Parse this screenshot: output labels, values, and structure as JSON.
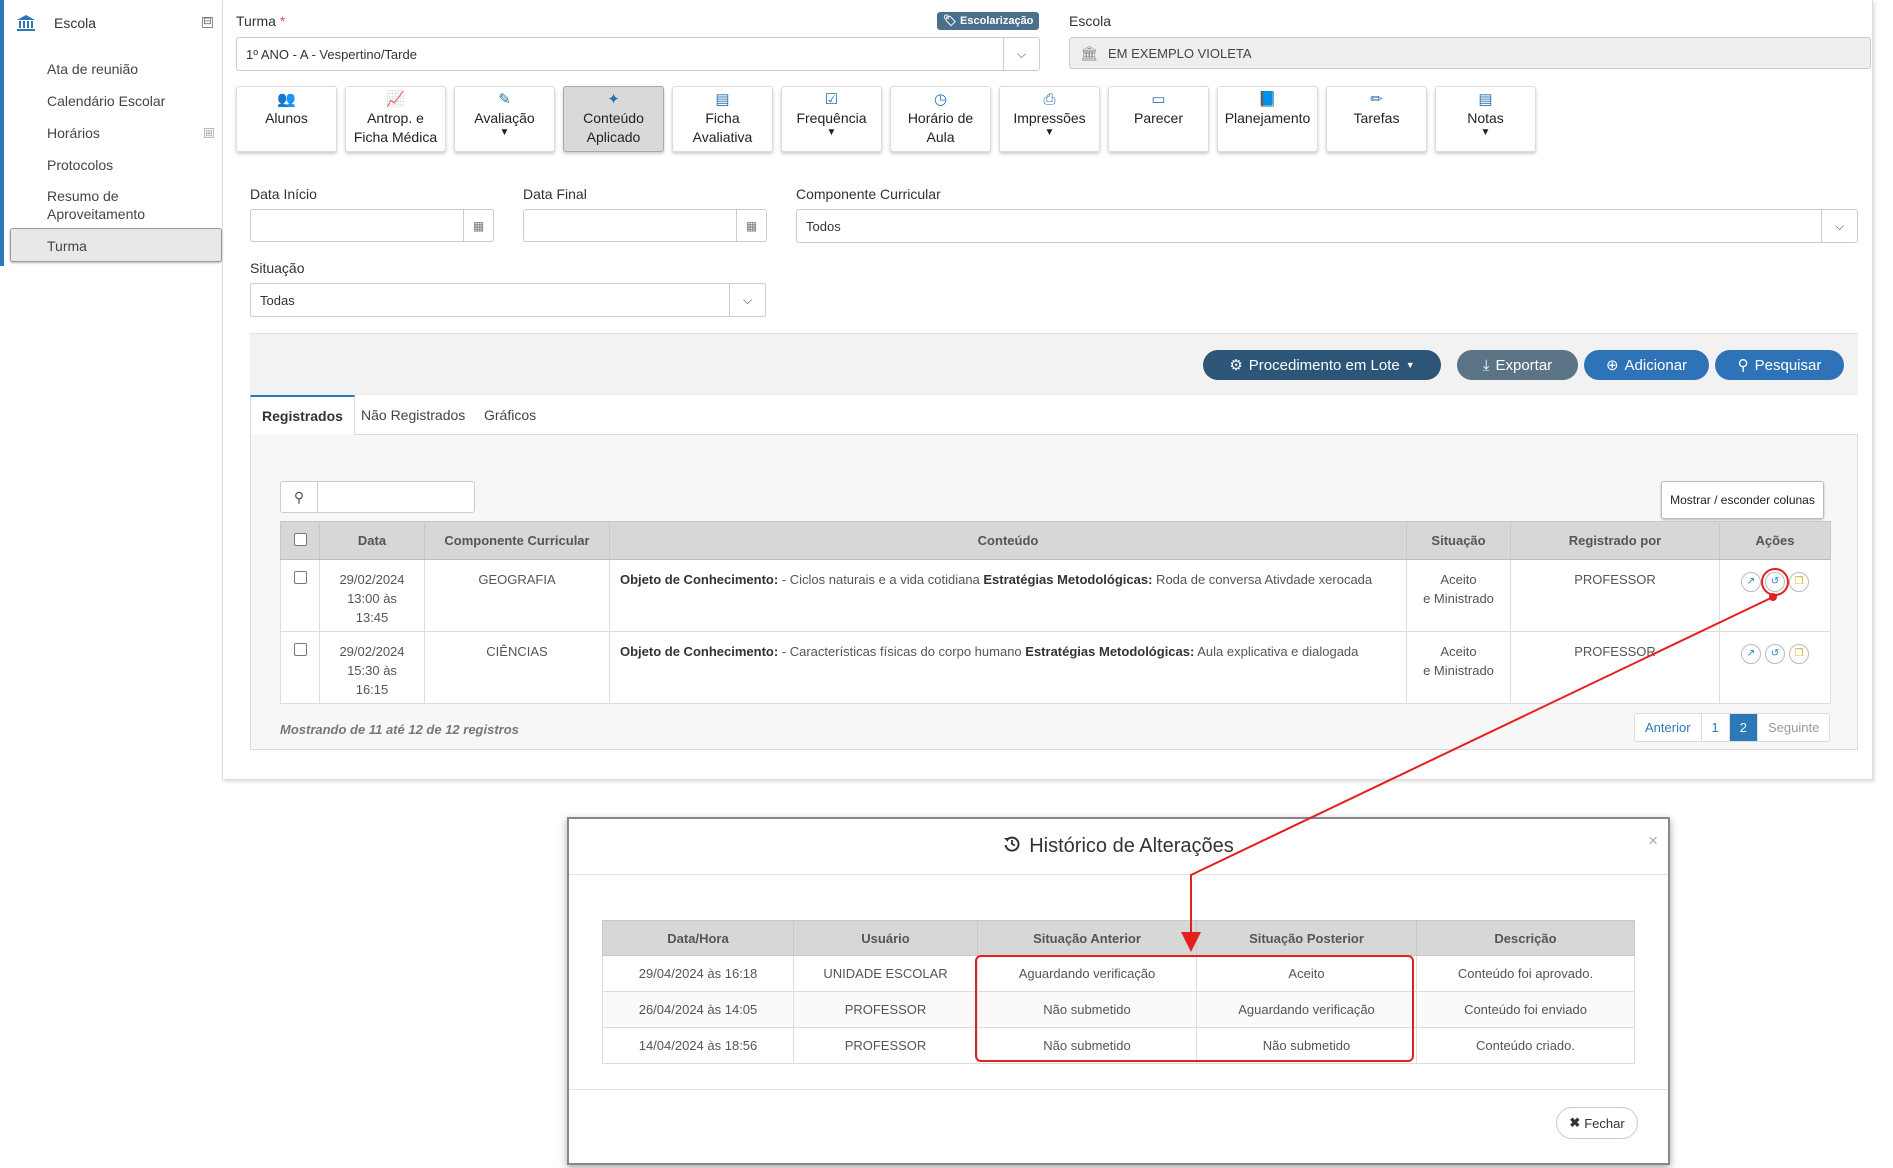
{
  "sidebar": {
    "header": "Escola",
    "header_toggle": "⊟",
    "items": [
      {
        "label": "Ata de reunião"
      },
      {
        "label": "Calendário Escolar"
      },
      {
        "label": "Horários",
        "toggle": "⊞"
      },
      {
        "label": "Protocolos"
      },
      {
        "label": "Resumo de Aproveitamento"
      },
      {
        "label": "Turma",
        "active": true
      }
    ]
  },
  "form": {
    "turma_label": "Turma",
    "turma_required": "*",
    "turma_value": "1º ANO - A - Vespertino/Tarde",
    "tag": "Escolarização",
    "escola_label": "Escola",
    "escola_value": "EM EXEMPLO VIOLETA"
  },
  "tiles": [
    {
      "icon": "users-icon",
      "glyph": "👥",
      "line1": "Alunos",
      "line2": ""
    },
    {
      "icon": "line-chart-icon",
      "glyph": "📈",
      "line1": "Antrop. e",
      "line2": "Ficha Médica"
    },
    {
      "icon": "edit-icon",
      "glyph": "✎",
      "line1": "Avaliação",
      "line2": "",
      "dropdown": true
    },
    {
      "icon": "magic-wand-icon",
      "glyph": "✦",
      "line1": "Conteúdo",
      "line2": "Aplicado",
      "active": true
    },
    {
      "icon": "table-icon",
      "glyph": "▤",
      "line1": "Ficha",
      "line2": "Avaliativa"
    },
    {
      "icon": "check-square-icon",
      "glyph": "☑",
      "line1": "Frequência",
      "line2": "",
      "dropdown": true
    },
    {
      "icon": "clock-icon",
      "glyph": "◷",
      "line1": "Horário de",
      "line2": "Aula"
    },
    {
      "icon": "print-icon",
      "glyph": "⎙",
      "line1": "Impressões",
      "line2": "",
      "dropdown": true
    },
    {
      "icon": "file-text-icon",
      "glyph": "▭",
      "line1": "Parecer",
      "line2": ""
    },
    {
      "icon": "book-icon",
      "glyph": "📘",
      "line1": "Planejamento",
      "line2": ""
    },
    {
      "icon": "pencil-icon",
      "glyph": "✏",
      "line1": "Tarefas",
      "line2": ""
    },
    {
      "icon": "list-icon",
      "glyph": "▤",
      "line1": "Notas",
      "line2": "",
      "dropdown": true
    }
  ],
  "filters": {
    "data_inicio_label": "Data Início",
    "data_final_label": "Data Final",
    "componente_label": "Componente Curricular",
    "componente_value": "Todos",
    "situacao_label": "Situação",
    "situacao_value": "Todas"
  },
  "actions": {
    "lote": "Procedimento em Lote",
    "exportar": "Exportar",
    "adicionar": "Adicionar",
    "pesquisar": "Pesquisar"
  },
  "tabs": [
    {
      "label": "Registrados",
      "active": true
    },
    {
      "label": "Não Registrados"
    },
    {
      "label": "Gráficos"
    }
  ],
  "table": {
    "columns_button": "Mostrar / esconder colunas",
    "headers": [
      "Data",
      "Componente Curricular",
      "Conteúdo",
      "Situação",
      "Registrado por",
      "Ações"
    ],
    "rows": [
      {
        "date_line1": "29/02/2024",
        "date_line2": "13:00 às",
        "date_line3": "13:45",
        "componente": "GEOGRAFIA",
        "label1": "Objeto de Conhecimento:",
        "text1": " - Ciclos naturais e a vida cotidiana ",
        "label2": "Estratégias Metodológicas:",
        "text2": " Roda de conversa Ativdade xerocada",
        "situacao_line1": "Aceito",
        "situacao_line2": "e Ministrado",
        "registrado": "PROFESSOR"
      },
      {
        "date_line1": "29/02/2024",
        "date_line2": "15:30 às",
        "date_line3": "16:15",
        "componente": "CIÊNCIAS",
        "label1": "Objeto de Conhecimento:",
        "text1": " - Características físicas do corpo humano ",
        "label2": "Estratégias Metodológicas:",
        "text2": " Aula explicativa e dialogada",
        "situacao_line1": "Aceito",
        "situacao_line2": "e Ministrado",
        "registrado": "PROFESSOR"
      }
    ],
    "showing": "Mostrando de 11 até 12 de 12 registros",
    "pager": {
      "prev": "Anterior",
      "p1": "1",
      "p2": "2",
      "next": "Seguinte"
    }
  },
  "modal": {
    "title": "Histórico de Alterações",
    "close_x": "×",
    "headers": [
      "Data/Hora",
      "Usuário",
      "Situação Anterior",
      "Situação Posterior",
      "Descrição"
    ],
    "rows": [
      {
        "datahora": "29/04/2024 às 16:18",
        "usuario": "UNIDADE ESCOLAR",
        "anterior": "Aguardando verificação",
        "posterior": "Aceito",
        "descricao": "Conteúdo foi aprovado."
      },
      {
        "datahora": "26/04/2024 às 14:05",
        "usuario": "PROFESSOR",
        "anterior": "Não submetido",
        "posterior": "Aguardando verificação",
        "descricao": "Conteúdo foi enviado"
      },
      {
        "datahora": "14/04/2024 às 18:56",
        "usuario": "PROFESSOR",
        "anterior": "Não submetido",
        "posterior": "Não submetido",
        "descricao": "Conteúdo criado."
      }
    ],
    "close_button": "Fechar"
  },
  "colors": {
    "primary": "#2b79b9",
    "dark_button": "#2c5577",
    "annotation_red": "#e32020"
  }
}
